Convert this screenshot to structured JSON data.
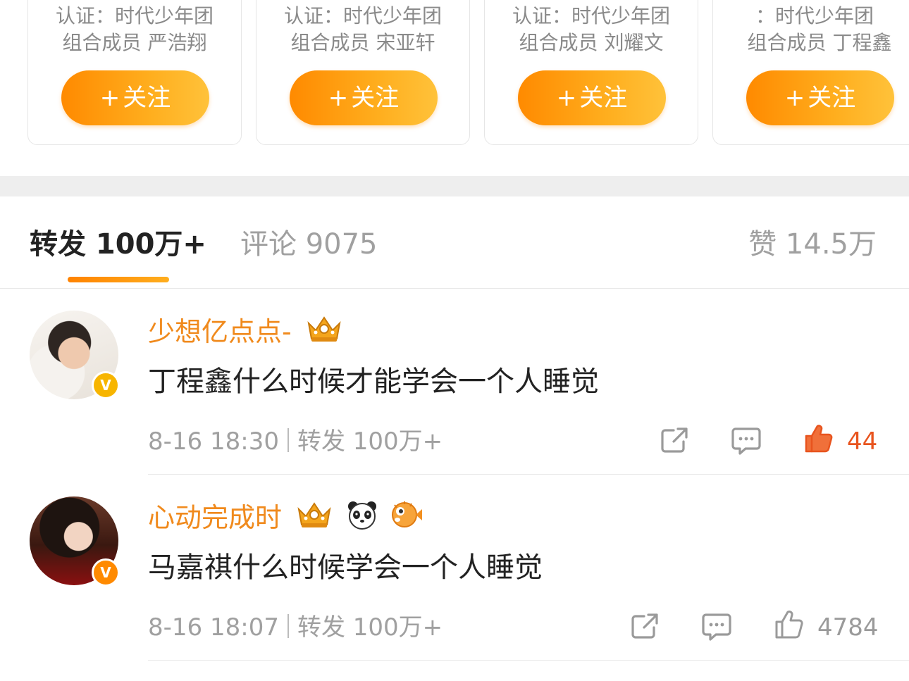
{
  "cards": [
    {
      "cert": "认证：时代少年团",
      "desc": "组合成员 严浩翔",
      "follow_label": "关注",
      "plus": "+"
    },
    {
      "cert": "认证：时代少年团",
      "desc": "组合成员 宋亚轩",
      "follow_label": "关注",
      "plus": "+"
    },
    {
      "cert": "认证：时代少年团",
      "desc": "组合成员 刘耀文",
      "follow_label": "关注",
      "plus": "+"
    },
    {
      "cert": "：时代少年团",
      "desc": "组合成员 丁程鑫",
      "follow_label": "关注",
      "plus": "+"
    }
  ],
  "tabs": {
    "repost": "转发 100万+",
    "comment": "评论 9075",
    "like": "赞 14.5万"
  },
  "comments": [
    {
      "name": "少想亿点点-",
      "badges": [
        "crown-icon"
      ],
      "text": "丁程鑫什么时候才能学会一个人睡觉",
      "time": "8-16 18:30",
      "repost": "转发 100万+",
      "likes": "44",
      "liked": true,
      "verify_badge": "V"
    },
    {
      "name": "心动完成时",
      "badges": [
        "crown-icon",
        "panda-icon",
        "pufferfish-icon"
      ],
      "text": "马嘉祺什么时候学会一个人睡觉",
      "time": "8-16 18:07",
      "repost": "转发 100万+",
      "likes": "4784",
      "liked": false,
      "verify_badge": "V"
    }
  ],
  "colors": {
    "accent_orange": "#ff8a00",
    "name_orange": "#f08a1d",
    "like_red": "#e8541e",
    "muted_gray": "#a0a0a0"
  }
}
